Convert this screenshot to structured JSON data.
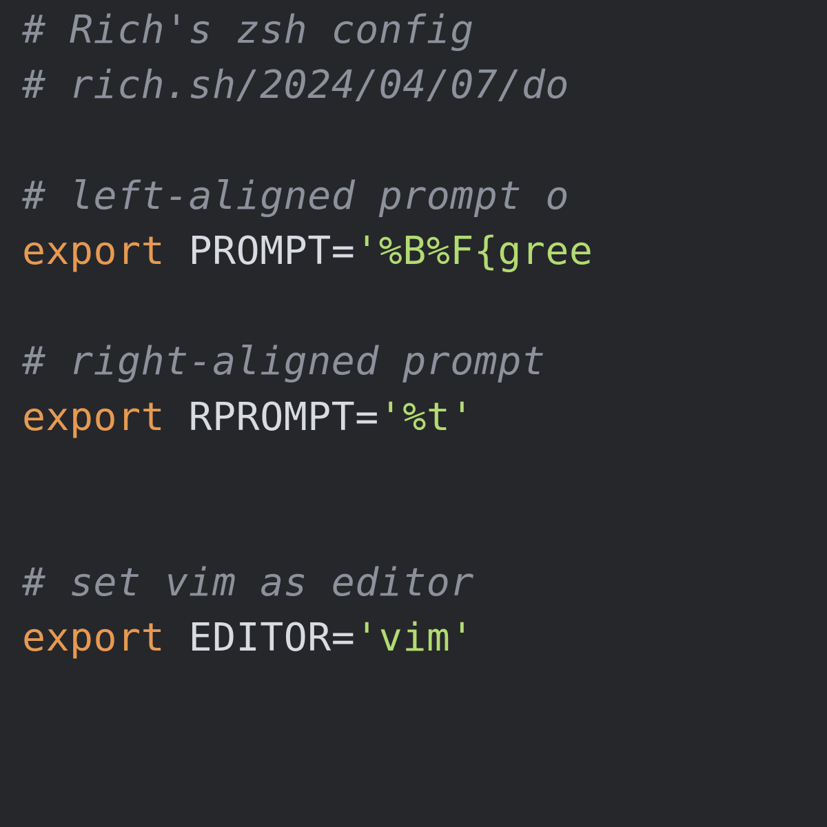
{
  "colors": {
    "background": "#26272b",
    "comment": "#8c919b",
    "keyword": "#e79a52",
    "variable": "#d9dbe2",
    "operator": "#d9dbe2",
    "string": "#b3db72"
  },
  "code": {
    "lines": [
      [
        {
          "type": "comment",
          "text": "# Rich's zsh config"
        }
      ],
      [
        {
          "type": "comment",
          "text": "# rich.sh/2024/04/07/do"
        }
      ],
      [],
      [
        {
          "type": "comment",
          "text": "# left-aligned prompt o"
        }
      ],
      [
        {
          "type": "keyword",
          "text": "export"
        },
        {
          "type": "plain",
          "text": " "
        },
        {
          "type": "variable",
          "text": "PROMPT"
        },
        {
          "type": "operator",
          "text": "="
        },
        {
          "type": "string",
          "text": "'%B%F{gree"
        }
      ],
      [],
      [
        {
          "type": "comment",
          "text": "# right-aligned prompt"
        }
      ],
      [
        {
          "type": "keyword",
          "text": "export"
        },
        {
          "type": "plain",
          "text": " "
        },
        {
          "type": "variable",
          "text": "RPROMPT"
        },
        {
          "type": "operator",
          "text": "="
        },
        {
          "type": "string",
          "text": "'%t'"
        }
      ],
      [],
      [],
      [
        {
          "type": "comment",
          "text": "# set vim as editor"
        }
      ],
      [
        {
          "type": "keyword",
          "text": "export"
        },
        {
          "type": "plain",
          "text": " "
        },
        {
          "type": "variable",
          "text": "EDITOR"
        },
        {
          "type": "operator",
          "text": "="
        },
        {
          "type": "string",
          "text": "'vim'"
        }
      ]
    ]
  }
}
